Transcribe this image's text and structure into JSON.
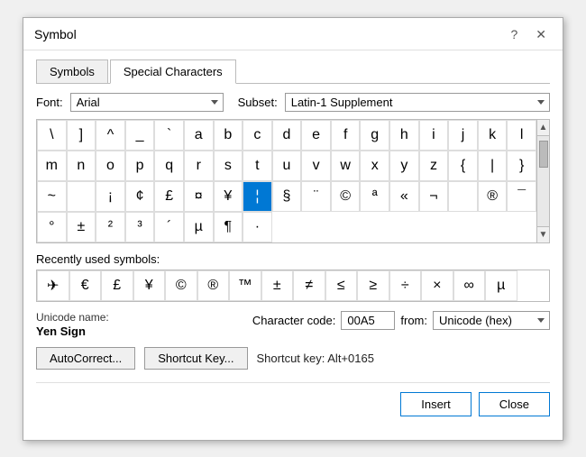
{
  "dialog": {
    "title": "Symbol",
    "help_btn": "?",
    "close_btn": "✕"
  },
  "tabs": [
    {
      "id": "symbols",
      "label": "Symbols",
      "active": false
    },
    {
      "id": "special-characters",
      "label": "Special Characters",
      "active": true
    }
  ],
  "font": {
    "label": "Font:",
    "value": "Arial"
  },
  "subset": {
    "label": "Subset:",
    "value": "Latin-1 Supplement"
  },
  "symbols": [
    "\\",
    "]",
    "^",
    "_",
    "`",
    "a",
    "b",
    "c",
    "d",
    "e",
    "f",
    "g",
    "h",
    "i",
    "j",
    "k",
    "l",
    "m",
    "n",
    "o",
    "p",
    "q",
    "r",
    "s",
    "t",
    "u",
    "v",
    "w",
    "x",
    "y",
    "z",
    "{",
    "|",
    "}",
    "~",
    " ",
    "¡",
    "¢",
    "£",
    "¤",
    "¥",
    "¦",
    "§",
    "¨",
    "©",
    "ª",
    "«",
    "¬",
    "­",
    "®",
    "¯",
    "°",
    "±",
    "²",
    "³",
    "´",
    "µ",
    "¶",
    "·"
  ],
  "selected_index": 41,
  "recently_used": [
    "✈",
    "€",
    "£",
    "¥",
    "©",
    "®",
    "™",
    "±",
    "≠",
    "≤",
    "≥",
    "÷",
    "×",
    "∞",
    "µ"
  ],
  "recent_label": "Recently used symbols:",
  "unicode_name_label": "Unicode name:",
  "unicode_name": "Yen Sign",
  "char_code_label": "Character code:",
  "char_code_value": "00A5",
  "from_label": "from:",
  "from_value": "Unicode (hex)",
  "shortcut_key_text": "Shortcut key: Alt+0165",
  "buttons": {
    "autocorrect": "AutoCorrect...",
    "shortcut_key": "Shortcut Key...",
    "insert": "Insert",
    "close": "Close"
  }
}
